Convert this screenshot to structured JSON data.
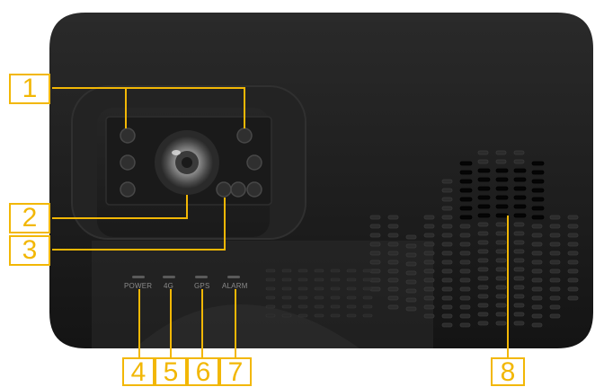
{
  "device": {
    "indicator_labels": {
      "power": "POWER",
      "fourg": "4G",
      "gps": "GPS",
      "alarm": "ALARM"
    },
    "callouts": {
      "c1": "1",
      "c2": "2",
      "c3": "3",
      "c4": "4",
      "c5": "5",
      "c6": "6",
      "c7": "7",
      "c8": "8"
    }
  },
  "colors": {
    "body": "#1c1c1c",
    "callout": "#f2b705",
    "led_off": "#5a5a5a",
    "background": "#ffffff"
  },
  "icons": [
    "camera-lens-icon",
    "ir-led-icon",
    "speaker-grille-icon",
    "status-led-icon"
  ]
}
